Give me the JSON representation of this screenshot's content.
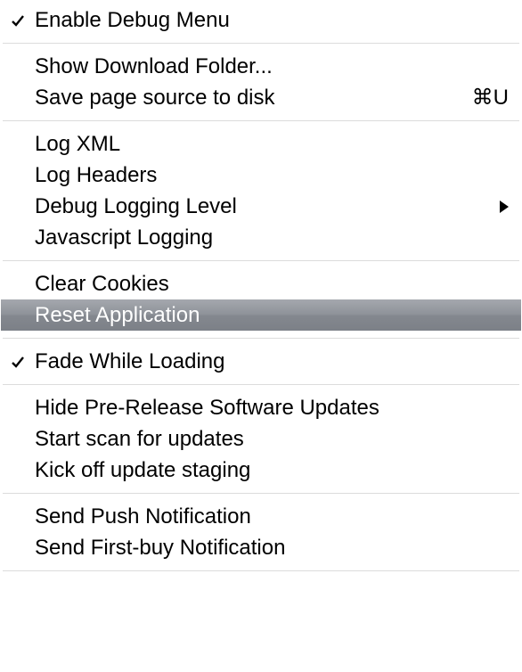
{
  "menu": {
    "items": [
      {
        "label": "Enable Debug Menu",
        "checked": true
      },
      {
        "separator": true
      },
      {
        "label": "Show Download Folder..."
      },
      {
        "label": "Save page source to disk",
        "shortcut": "⌘U"
      },
      {
        "separator": true
      },
      {
        "label": "Log XML"
      },
      {
        "label": "Log Headers"
      },
      {
        "label": "Debug Logging Level",
        "submenu": true
      },
      {
        "label": "Javascript Logging"
      },
      {
        "separator": true
      },
      {
        "label": "Clear Cookies"
      },
      {
        "label": "Reset Application",
        "selected": true
      },
      {
        "separator": true
      },
      {
        "label": "Fade While Loading",
        "checked": true
      },
      {
        "separator": true
      },
      {
        "label": "Hide Pre-Release Software Updates"
      },
      {
        "label": "Start scan for updates"
      },
      {
        "label": "Kick off update staging"
      },
      {
        "separator": true
      },
      {
        "label": "Send Push Notification"
      },
      {
        "label": "Send First-buy Notification"
      },
      {
        "separator": true
      }
    ]
  }
}
